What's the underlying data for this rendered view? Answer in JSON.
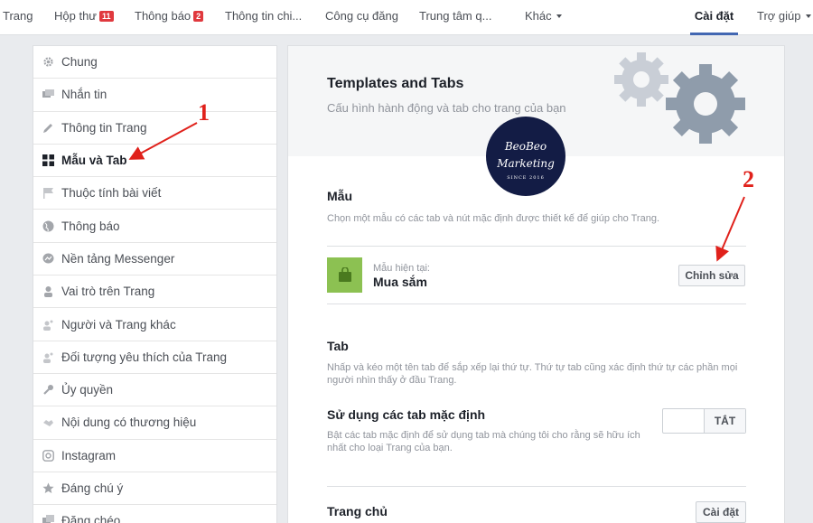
{
  "nav": {
    "page": "Trang",
    "inbox": "Hộp thư",
    "inbox_count": "11",
    "notifications": "Thông báo",
    "notifications_count": "2",
    "info": "Thông tin chi...",
    "publishing_tools": "Công cụ đăng",
    "center": "Trung tâm q...",
    "more": "Khác",
    "settings": "Cài đặt",
    "help": "Trợ giúp"
  },
  "sidebar": {
    "items": [
      {
        "label": "Chung",
        "icon": "gear-icon"
      },
      {
        "label": "Nhắn tin",
        "icon": "chat-icon"
      },
      {
        "label": "Thông tin Trang",
        "icon": "pencil-icon"
      },
      {
        "label": "Mẫu và Tab",
        "icon": "grid-icon"
      },
      {
        "label": "Thuộc tính bài viết",
        "icon": "flag-icon"
      },
      {
        "label": "Thông báo",
        "icon": "globe-icon"
      },
      {
        "label": "Nền tảng Messenger",
        "icon": "messenger-icon"
      },
      {
        "label": "Vai trò trên Trang",
        "icon": "person-icon"
      },
      {
        "label": "Người và Trang khác",
        "icon": "people-icon"
      },
      {
        "label": "Đối tượng yêu thích của Trang",
        "icon": "people-icon"
      },
      {
        "label": "Ủy quyền",
        "icon": "wrench-icon"
      },
      {
        "label": "Nội dung có thương hiệu",
        "icon": "handshake-icon"
      },
      {
        "label": "Instagram",
        "icon": "instagram-icon"
      },
      {
        "label": "Đáng chú ý",
        "icon": "star-icon"
      },
      {
        "label": "Đăng chéo",
        "icon": "crosspost-icon"
      }
    ]
  },
  "main": {
    "title": "Templates and Tabs",
    "subtitle": "Cấu hình hành động và tab cho trang của bạn",
    "logo": {
      "line1": "BeoBeo",
      "line2": "Marketing",
      "line3": "SINCE 2016"
    },
    "template_section": {
      "title": "Mẫu",
      "desc": "Chọn một mẫu có các tab và nút mặc định được thiết kế để giúp cho Trang.",
      "current_label": "Mẫu hiện tại:",
      "current_value": "Mua sắm",
      "edit_button": "Chỉnh sửa"
    },
    "tab_section": {
      "title": "Tab",
      "desc": "Nhấp và kéo một tên tab để sắp xếp lại thứ tự. Thứ tự tab cũng xác định thứ tự các phần mọi người nhìn thấy ở đầu Trang.",
      "default_tabs_title": "Sử dụng các tab mặc định",
      "default_tabs_desc": "Bật các tab mặc định để sử dụng tab mà chúng tôi cho rằng sẽ hữu ích nhất cho loại Trang của bạn.",
      "toggle_state": "TẮT",
      "home_tab": "Trang chủ",
      "home_settings_button": "Cài đặt"
    }
  },
  "annotations": {
    "one": "1",
    "two": "2",
    "color": "#e0211b"
  }
}
